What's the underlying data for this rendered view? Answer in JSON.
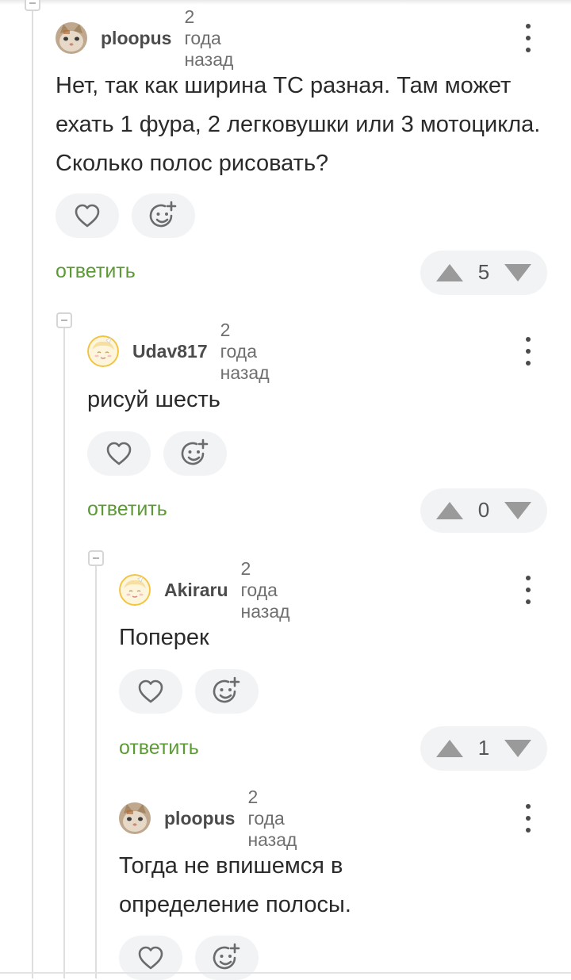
{
  "comments": [
    {
      "author": "ploopus",
      "time": "2 года назад",
      "text": "Нет, так как ширина ТС разная. Там может ехать 1 фура, 2 легковушки или 3 мотоцикла. Сколько полос рисовать?",
      "reply_label": "ответить",
      "rating": "5",
      "avatar_icon": "cat-avatar-icon"
    },
    {
      "author": "Udav817",
      "time": "2 года назад",
      "text": "рисуй шесть",
      "reply_label": "ответить",
      "rating": "0",
      "avatar_icon": "cartoon-face-avatar-icon"
    },
    {
      "author": "Akiraru",
      "time": "2 года назад",
      "text": "Поперек",
      "reply_label": "ответить",
      "rating": "1",
      "avatar_icon": "cartoon-face-avatar-icon"
    },
    {
      "author": "ploopus",
      "time": "2 года назад",
      "text": "Тогда не впишемся в определение полосы.",
      "avatar_icon": "cat-avatar-icon"
    }
  ],
  "colors": {
    "reply_link": "#5c9a35",
    "pill_background": "#f2f3f5",
    "icon_gray": "#6b6b6b"
  }
}
